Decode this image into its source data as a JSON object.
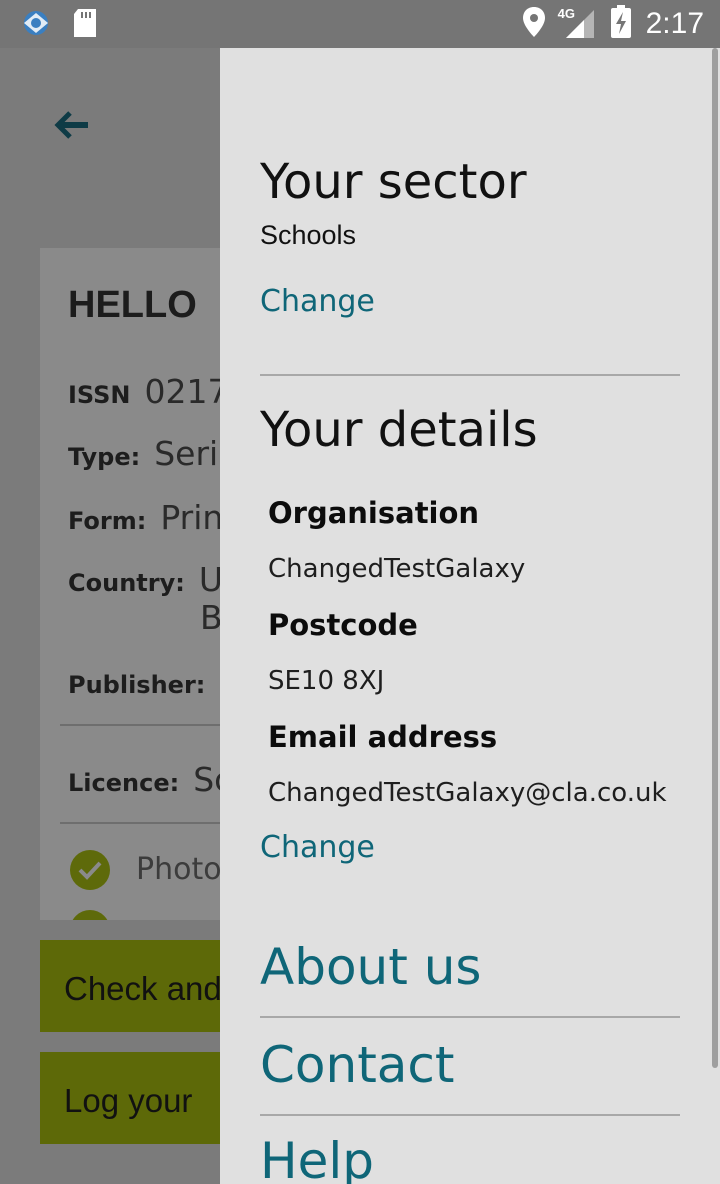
{
  "status_bar": {
    "network": "4G",
    "time": "2:17"
  },
  "background": {
    "card": {
      "title": "HELLO",
      "rows": [
        {
          "label": "ISSN",
          "value": "0217"
        },
        {
          "label": "Type:",
          "value": "Seria"
        },
        {
          "label": "Form:",
          "value": "Prin"
        },
        {
          "label": "Country:",
          "value": "U"
        },
        {
          "label": "Publisher:",
          "value": ""
        },
        {
          "label": "Licence:",
          "value": "Sc"
        }
      ],
      "country_line2": "B",
      "check_item": "Photo"
    },
    "buttons": [
      "Check and",
      "Log your"
    ]
  },
  "drawer": {
    "sector": {
      "heading": "Your sector",
      "value": "Schools",
      "change_label": "Change"
    },
    "details": {
      "heading": "Your details",
      "fields": [
        {
          "label": "Organisation",
          "value": "ChangedTestGalaxy"
        },
        {
          "label": "Postcode",
          "value": "SE10 8XJ"
        },
        {
          "label": "Email address",
          "value": "ChangedTestGalaxy@cla.co.uk"
        }
      ],
      "change_label": "Change"
    },
    "nav": [
      "About us",
      "Contact",
      "Help"
    ]
  },
  "colors": {
    "link": "#0f6678",
    "drawer_bg": "#e0e0e0",
    "olive_button": "#5d6908"
  }
}
